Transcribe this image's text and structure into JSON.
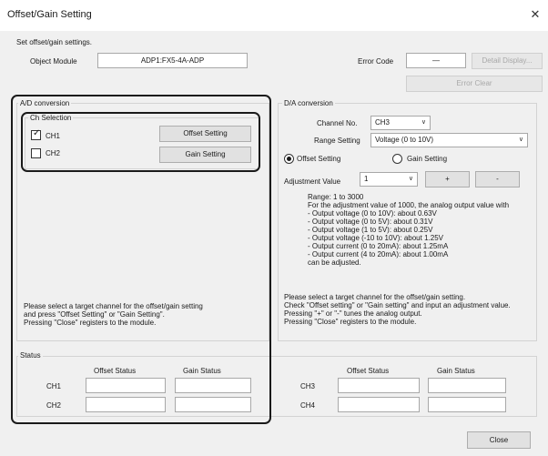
{
  "window": {
    "title": "Offset/Gain Setting",
    "close_glyph": "✕",
    "instruction": "Set offset/gain settings."
  },
  "module": {
    "label": "Object Module",
    "value": "ADP1:FX5-4A-ADP"
  },
  "error": {
    "label": "Error Code",
    "value": "—",
    "detail_button": "Detail Display...",
    "clear_button": "Error Clear"
  },
  "ad": {
    "group_label": "A/D conversion",
    "ch_selection_label": "Ch Selection",
    "channels": [
      {
        "label": "CH1",
        "checked": true
      },
      {
        "label": "CH2",
        "checked": false
      }
    ],
    "offset_button": "Offset Setting",
    "gain_button": "Gain Setting",
    "help_lines": "Please select a target channel for the offset/gain setting\nand press \"Offset Setting\" or \"Gain Setting\".\nPressing \"Close\" registers to the module."
  },
  "da": {
    "group_label": "D/A conversion",
    "channel_label": "Channel No.",
    "channel_value": "CH3",
    "range_label": "Range Setting",
    "range_value": "Voltage (0 to 10V)",
    "offset_radio": "Offset Setting",
    "gain_radio": "Gain Setting",
    "selected_radio": "offset",
    "adjust_label": "Adjustment Value",
    "adjust_value": "1",
    "plus_button": "+",
    "minus_button": "-",
    "range_info": "Range: 1 to 3000\nFor the adjustment value of 1000, the analog output value with\n- Output voltage (0 to 10V): about 0.63V\n- Output voltage (0 to 5V): about 0.31V\n- Output voltage (1 to 5V): about 0.25V\n- Output voltage (-10 to 10V): about 1.25V\n- Output current (0 to 20mA): about 1.25mA\n- Output current (4 to 20mA): about 1.00mA\ncan be adjusted.",
    "help_lines": "Please select a target channel for the offset/gain setting.\nCheck \"Offset setting\" or \"Gain setting\" and input an adjustment value.\nPressing \"+\" or \"-\" tunes the analog output.\nPressing \"Close\" registers to the module."
  },
  "status": {
    "group_label": "Status",
    "offset_header": "Offset Status",
    "gain_header": "Gain Status",
    "left_rows": [
      {
        "label": "CH1",
        "offset": "",
        "gain": ""
      },
      {
        "label": "CH2",
        "offset": "",
        "gain": ""
      }
    ],
    "right_rows": [
      {
        "label": "CH3",
        "offset": "",
        "gain": ""
      },
      {
        "label": "CH4",
        "offset": "",
        "gain": ""
      }
    ]
  },
  "footer": {
    "close_button": "Close"
  }
}
